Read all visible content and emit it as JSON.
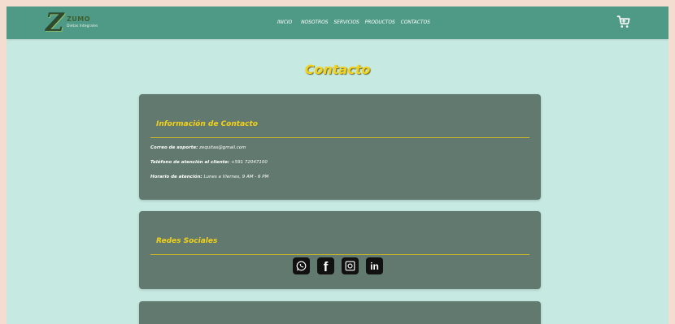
{
  "brand": {
    "name": "ZUMO",
    "tagline": "Dietas Integrales"
  },
  "nav": {
    "links": [
      {
        "label": "INICIO"
      },
      {
        "label": "NOSOTROS"
      },
      {
        "label": "SERVICIOS"
      },
      {
        "label": "PRODUCTOS"
      },
      {
        "label": "CONTACTOS"
      }
    ],
    "cart_icon": "cart-icon"
  },
  "page": {
    "title": "Contacto"
  },
  "contact_card": {
    "title": "Información de Contacto",
    "lines": [
      {
        "label": "Correo de soporte:",
        "value": "zequitas@gmail.com"
      },
      {
        "label": "Teléfono de atención al cliente:",
        "value": "+591 72047100"
      },
      {
        "label": "Horario de atención:",
        "value": "Lunes a Viernes, 9 AM - 6 PM"
      }
    ]
  },
  "social_card": {
    "title": "Redes Sociales",
    "icons": [
      "whatsapp-icon",
      "facebook-icon",
      "instagram-icon",
      "linkedin-icon"
    ],
    "linkedin_text": "in",
    "facebook_text": "f"
  },
  "colors": {
    "navbar": "#4f9a86",
    "background": "#c6eae1",
    "card": "#62796f",
    "accent": "#f2d21b"
  }
}
